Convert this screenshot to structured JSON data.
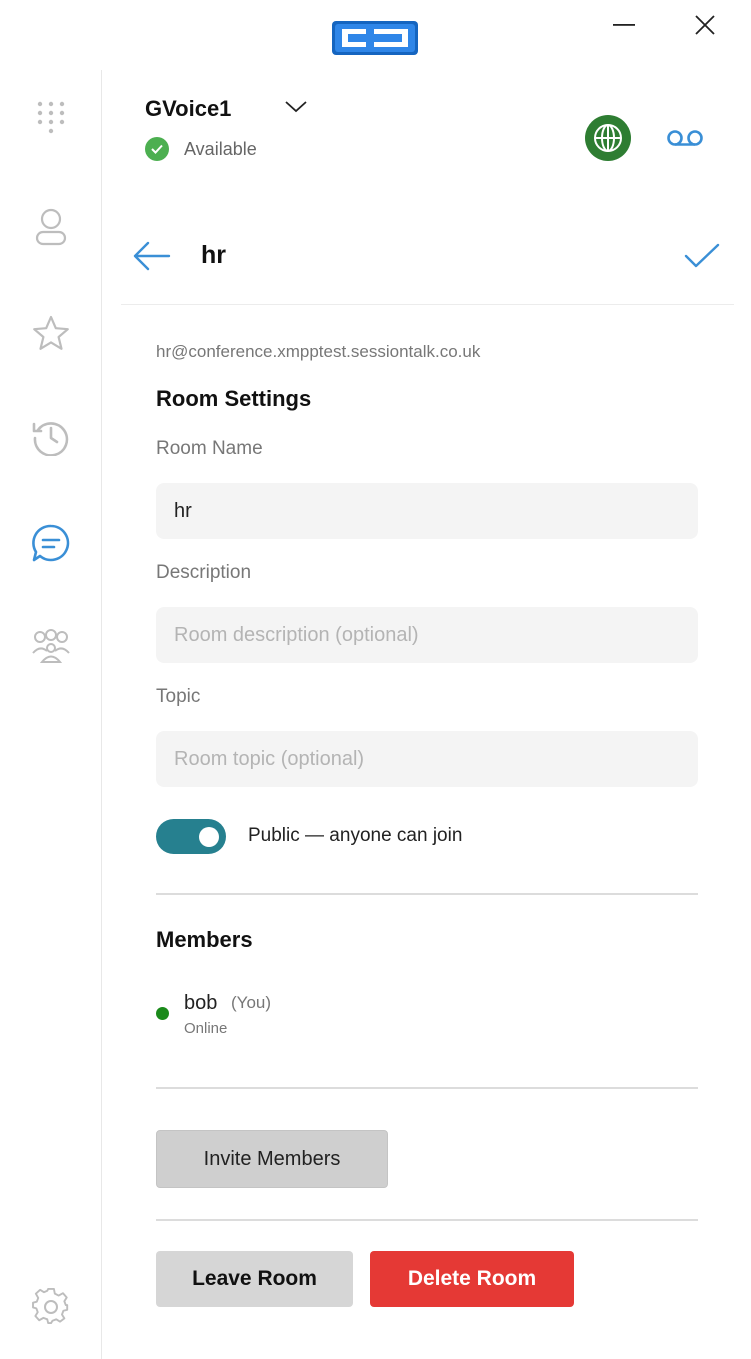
{
  "account": {
    "name": "GVoice1",
    "status": "Available"
  },
  "room": {
    "title": "hr",
    "jid": "hr@conference.xmpptest.sessiontalk.co.uk",
    "settings_heading": "Room Settings",
    "name_label": "Room Name",
    "name_value": "hr",
    "description_label": "Description",
    "description_placeholder": "Room description (optional)",
    "topic_label": "Topic",
    "topic_placeholder": "Room topic (optional)",
    "public_toggle_label": "Public — anyone can join",
    "public_enabled": true
  },
  "members": {
    "heading": "Members",
    "list": [
      {
        "name": "bob",
        "tag": "(You)",
        "status": "Online",
        "status_color": "#1a8a1a"
      }
    ]
  },
  "actions": {
    "invite_label": "Invite Members",
    "leave_label": "Leave Room",
    "delete_label": "Delete Room"
  },
  "sidebar": {
    "items": [
      {
        "icon": "dialpad-icon"
      },
      {
        "icon": "contact-icon"
      },
      {
        "icon": "star-icon"
      },
      {
        "icon": "history-icon"
      },
      {
        "icon": "chat-icon",
        "active": true
      },
      {
        "icon": "group-icon"
      },
      {
        "icon": "settings-icon"
      }
    ]
  },
  "colors": {
    "accent": "#3a8fd6",
    "toggle_on": "#26808f",
    "available": "#4caf50",
    "globe": "#2e7d32",
    "danger": "#e53935"
  }
}
